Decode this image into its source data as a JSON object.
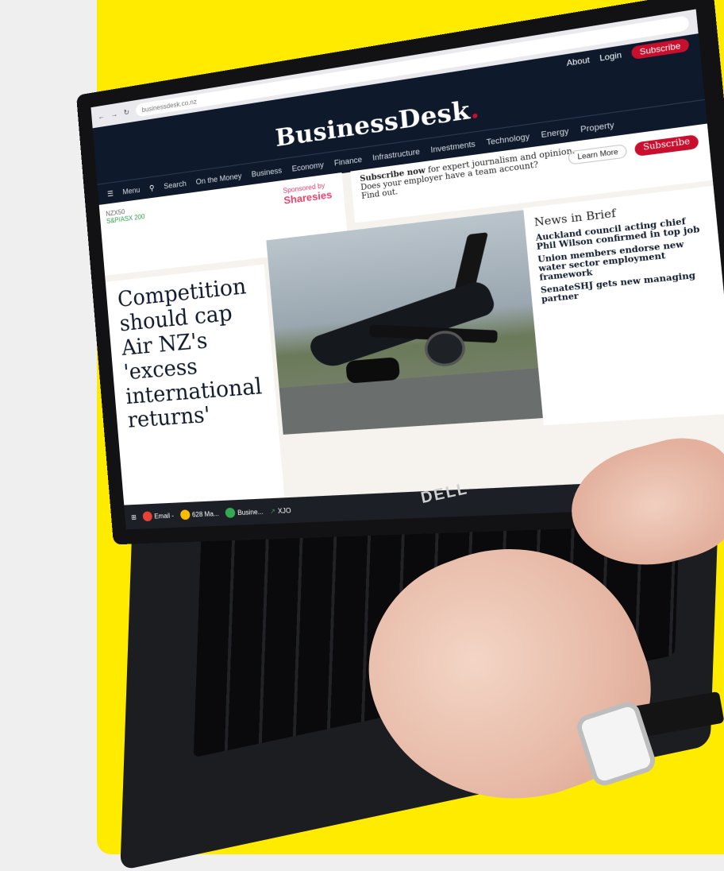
{
  "browser": {
    "url": "businessdesk.co.nz"
  },
  "site": {
    "logo": "BusinessDesk",
    "logo_dot": ".",
    "top_links": [
      "About",
      "Login"
    ],
    "subscribe_label": "Subscribe",
    "menu_label": "Menu",
    "search_label": "Search",
    "nav": [
      "On the Money",
      "Business",
      "Economy",
      "Finance",
      "Infrastructure",
      "Investments",
      "Technology",
      "Energy",
      "Property"
    ]
  },
  "promo": {
    "lead": "Subscribe now",
    "text": " for expert journalism and opinion.",
    "team_text": "Does your employer have a team account?",
    "find_out": "Find out.",
    "learn_more": "Learn More",
    "subscribe": "Subscribe"
  },
  "sponsor": {
    "label": "Sponsored by",
    "name": "Sharesies"
  },
  "ticker": {
    "line1": "NZX50",
    "line2": "S&P/ASX 200"
  },
  "article": {
    "headline": "Competition should cap Air NZ's 'excess international returns'"
  },
  "news_in_brief": {
    "title": "News in Brief",
    "items": [
      {
        "headline": "Auckland council acting chief Phil Wilson confirmed in top job"
      },
      {
        "headline": "Union members endorse new water sector employment framework"
      },
      {
        "headline": "SenateSHJ gets new managing partner"
      }
    ]
  },
  "taskbar": {
    "items": [
      "Email -",
      "628 Ma...",
      "Busine..."
    ],
    "xjo": "XJO"
  },
  "laptop": {
    "brand": "DELL"
  }
}
